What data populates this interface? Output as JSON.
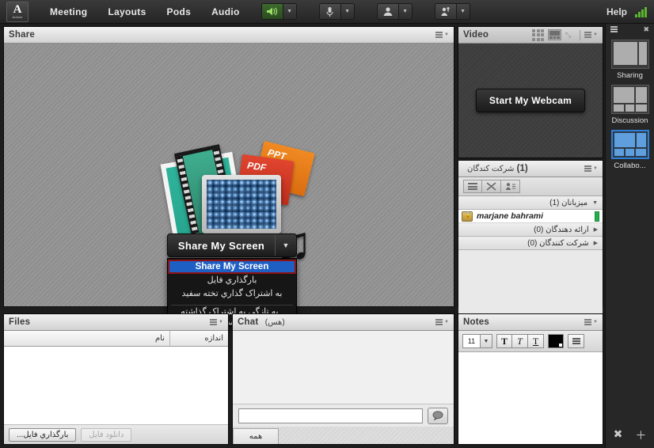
{
  "menubar": {
    "logo_glyph": "A",
    "logo_text": "Adobe",
    "items": [
      {
        "label": "Meeting"
      },
      {
        "label": "Layouts"
      },
      {
        "label": "Pods"
      },
      {
        "label": "Audio"
      }
    ],
    "tools": [
      {
        "name": "speaker",
        "glyph": "🔊",
        "state": "active"
      },
      {
        "name": "microphone",
        "glyph": "🎙",
        "state": "idle"
      },
      {
        "name": "camera",
        "glyph": "👤",
        "state": "idle"
      },
      {
        "name": "raise-hand",
        "glyph": "👤",
        "state": "idle"
      }
    ],
    "help_label": "Help",
    "connection_icon": "signal-bars"
  },
  "share_pod": {
    "title": "Share",
    "button_label": "Share My Screen",
    "menu": {
      "highlighted": "Share My Screen",
      "items": [
        {
          "label": "بارگذاري فایل"
        },
        {
          "label": "به اشتراک گذاري تخته سفید"
        }
      ],
      "submenu_label": "به تازگي به اشتراک گذاشته شده",
      "submenu_arrow": "▶"
    },
    "artwork": {
      "ppt_label": "PPT",
      "pdf_label": "PDF",
      "note_glyph": "♫"
    }
  },
  "video_pod": {
    "title": "Video",
    "start_button": "Start My Webcam",
    "fullscreen_glyph": "⤡"
  },
  "attendees_pod": {
    "title": "شرکت کندگان",
    "count_label": "(1)",
    "groups": [
      {
        "label": "میزبانان (1)",
        "expanded": true,
        "tri": "▼"
      },
      {
        "label": "ارائه دهندگان (0)",
        "expanded": false,
        "tri": "▶"
      },
      {
        "label": "شرکت کنندگان (0)",
        "expanded": false,
        "tri": "▶"
      }
    ],
    "user": {
      "name": "marjane bahrami",
      "status_color": "#22b04a"
    }
  },
  "files_pod": {
    "title": "Files",
    "columns": {
      "name": "نام",
      "size": "اندازه"
    },
    "rows": [],
    "upload_button": "بارگذاري فایل...",
    "download_button": "دانلود فایل"
  },
  "chat_pod": {
    "title": "Chat",
    "title_suffix": "(هس)",
    "input_value": "",
    "send_icon": "💬",
    "tab_label": "همه"
  },
  "notes_pod": {
    "title": "Notes",
    "font_size": "11",
    "bold_label": "T",
    "italic_label": "T",
    "underline_label": "T",
    "color": "#000000",
    "content": ""
  },
  "layout_bar": {
    "close_glyph": "✖",
    "layouts": [
      {
        "label": "Sharing",
        "selected": false
      },
      {
        "label": "Discussion",
        "selected": false
      },
      {
        "label": "Collabo...",
        "selected": true
      }
    ],
    "swap_glyph": "✖",
    "add_glyph": "＋"
  }
}
